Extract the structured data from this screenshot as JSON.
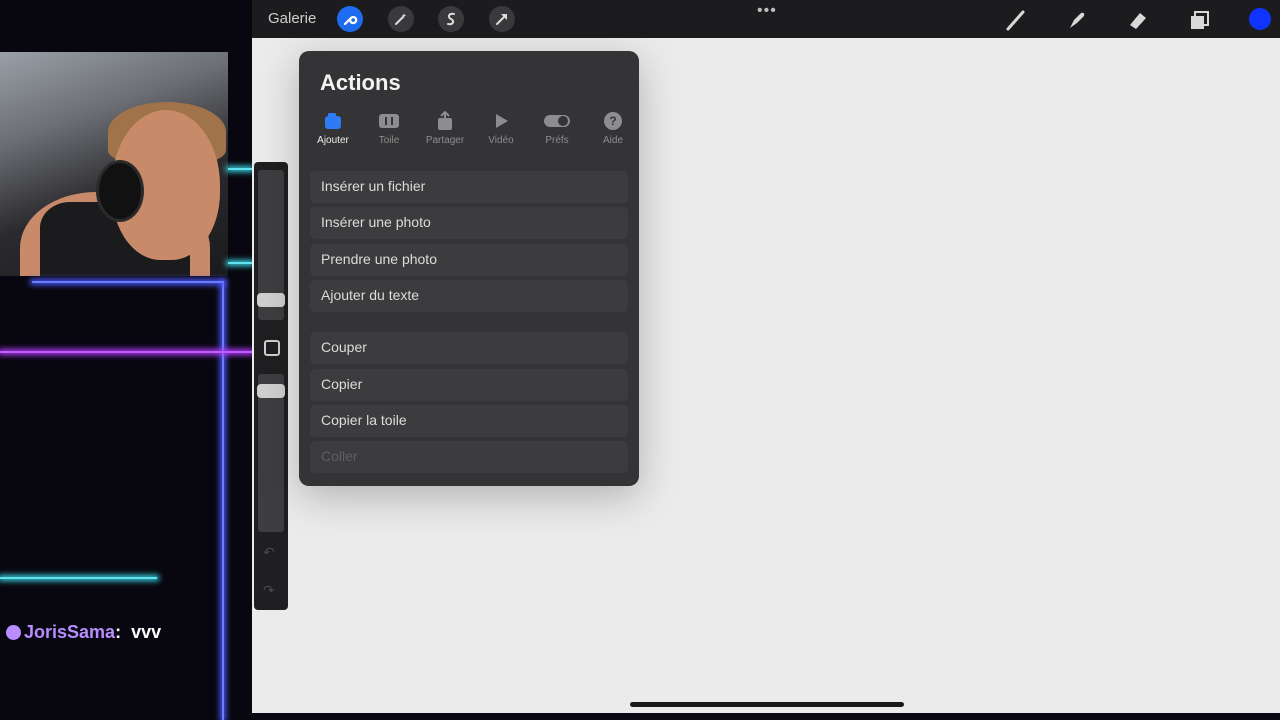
{
  "stream_overlay": {
    "chat_user": "JorisSama",
    "chat_separator": ":",
    "chat_message": "vvv",
    "colors": {
      "neon_blue": "#6b7cff",
      "neon_purple": "#b43cff",
      "neon_cyan": "#3ad6e6",
      "user": "#b98cff"
    }
  },
  "toolbar": {
    "gallery_label": "Galerie",
    "left_icons": [
      "wrench-icon",
      "magic-wand-icon",
      "selection-icon",
      "transform-arrow-icon"
    ],
    "more_label": "•••",
    "right_icons": [
      "brush-icon",
      "smudge-icon",
      "eraser-icon",
      "layers-icon"
    ],
    "current_color": "#1034ff"
  },
  "actions_panel": {
    "title": "Actions",
    "tabs": [
      {
        "label": "Ajouter",
        "icon": "add-icon",
        "active": true
      },
      {
        "label": "Toile",
        "icon": "canvas-icon",
        "active": false
      },
      {
        "label": "Partager",
        "icon": "share-icon",
        "active": false
      },
      {
        "label": "Vidéo",
        "icon": "play-icon",
        "active": false
      },
      {
        "label": "Préfs",
        "icon": "toggle-icon",
        "active": false
      },
      {
        "label": "Aide",
        "icon": "help-icon",
        "active": false
      }
    ],
    "group1": [
      "Insérer un fichier",
      "Insérer une photo",
      "Prendre une photo",
      "Ajouter du texte"
    ],
    "group2": [
      "Couper",
      "Copier",
      "Copier la toile",
      "Coller"
    ]
  }
}
